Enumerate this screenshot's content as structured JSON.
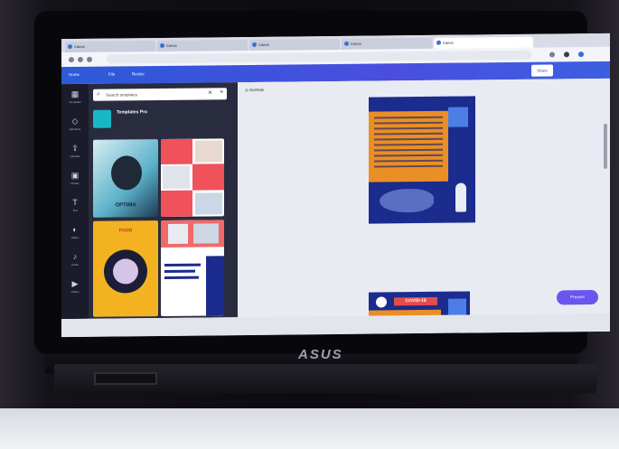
{
  "browser": {
    "tabs": [
      {
        "label": "Canva"
      },
      {
        "label": "Canva"
      },
      {
        "label": "Canva"
      },
      {
        "label": "Canva"
      },
      {
        "label": "Canva"
      }
    ],
    "url": ""
  },
  "topbar": {
    "items": [
      "Home",
      "File",
      "Resize"
    ],
    "title": "",
    "share_label": "Share",
    "download_label": ""
  },
  "sidebar": {
    "items": [
      {
        "label": "Templates",
        "icon": "template-icon"
      },
      {
        "label": "Elements",
        "icon": "elements-icon"
      },
      {
        "label": "Uploads",
        "icon": "upload-icon"
      },
      {
        "label": "Photos",
        "icon": "photo-icon"
      },
      {
        "label": "Text",
        "icon": "text-icon"
      },
      {
        "label": "Styles",
        "icon": "styles-icon"
      },
      {
        "label": "Audio",
        "icon": "audio-icon"
      },
      {
        "label": "Videos",
        "icon": "video-icon"
      }
    ]
  },
  "panel": {
    "search_placeholder": "Search templates",
    "promo_title": "Templates Pro",
    "promo_text": "",
    "thumbs": [
      {
        "caption": "OPTIMA"
      },
      {
        "caption": ""
      },
      {
        "caption": "FOOD"
      },
      {
        "caption": ""
      }
    ]
  },
  "canvas": {
    "animate_label": "Animate",
    "page2_label": "",
    "covid_text": "COVID-19",
    "present_label": "Present"
  },
  "status": {
    "notes_label": "",
    "zoom": ""
  },
  "device": {
    "brand": "ASUS"
  },
  "colors": {
    "canva_blue": "#3c5fe0",
    "panel_dark": "#292c3f",
    "poster_blue": "#1b2b8e",
    "poster_orange": "#ea8f25",
    "present_purple": "#6a55ee"
  }
}
